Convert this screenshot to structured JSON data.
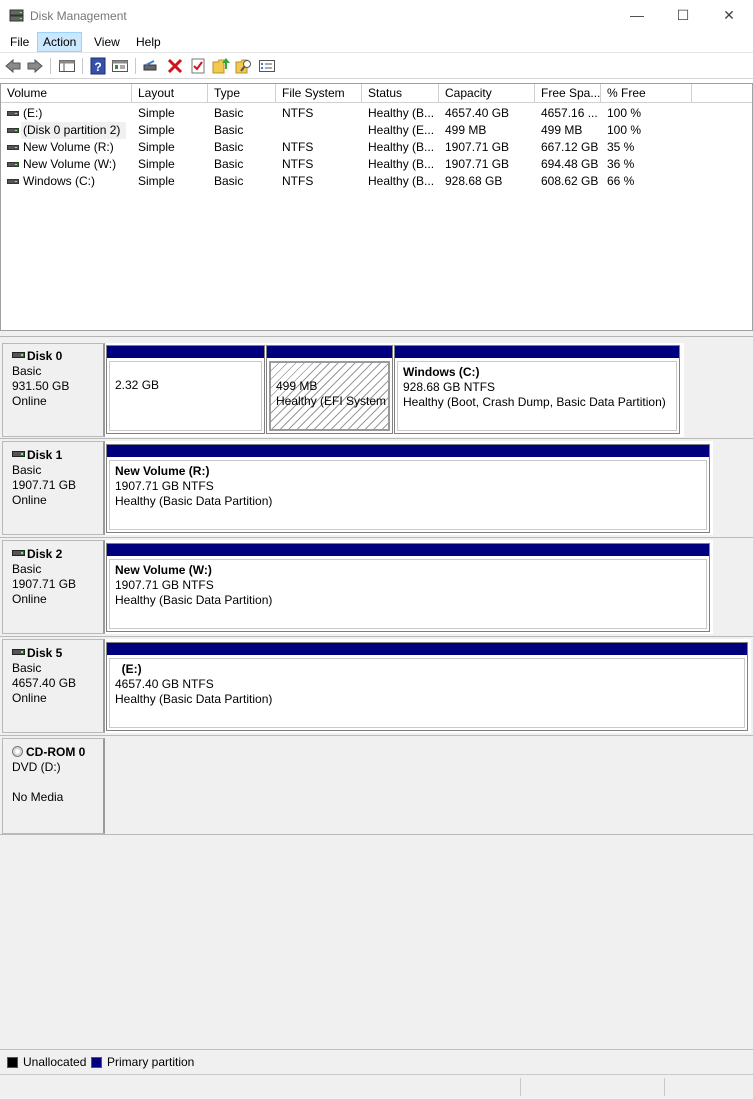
{
  "window": {
    "title": "Disk Management",
    "minimize_label": "—",
    "maximize_label": "☐",
    "close_label": "✕"
  },
  "menu": {
    "items": [
      "File",
      "Action",
      "View",
      "Help"
    ],
    "active": "Action"
  },
  "toolbar": {
    "buttons": [
      "back-icon",
      "forward-icon",
      "console-tree-icon",
      "help-icon",
      "properties-icon",
      "connect-icon",
      "delete-icon",
      "check-icon",
      "folder-up-icon",
      "search-folder-icon",
      "list-view-icon"
    ]
  },
  "volume_list": {
    "columns": [
      "Volume",
      "Layout",
      "Type",
      "File System",
      "Status",
      "Capacity",
      "Free Spa...",
      "% Free"
    ],
    "rows": [
      {
        "volume": " (E:)",
        "layout": "Simple",
        "type": "Basic",
        "fs": "NTFS",
        "status": "Healthy (B...",
        "capacity": "4657.40 GB",
        "free": "4657.16 ...",
        "pct": "100 %"
      },
      {
        "volume": "(Disk 0 partition 2)",
        "layout": "Simple",
        "type": "Basic",
        "fs": "",
        "status": "Healthy (E...",
        "capacity": "499 MB",
        "free": "499 MB",
        "pct": "100 %"
      },
      {
        "volume": "New Volume (R:)",
        "layout": "Simple",
        "type": "Basic",
        "fs": "NTFS",
        "status": "Healthy (B...",
        "capacity": "1907.71 GB",
        "free": "667.12 GB",
        "pct": "35 %"
      },
      {
        "volume": "New Volume (W:)",
        "layout": "Simple",
        "type": "Basic",
        "fs": "NTFS",
        "status": "Healthy (B...",
        "capacity": "1907.71 GB",
        "free": "694.48 GB",
        "pct": "36 %"
      },
      {
        "volume": "Windows (C:)",
        "layout": "Simple",
        "type": "Basic",
        "fs": "NTFS",
        "status": "Healthy (B...",
        "capacity": "928.68 GB",
        "free": "608.62 GB",
        "pct": "66 %"
      }
    ]
  },
  "disks": {
    "disk0": {
      "name": "Disk 0",
      "type": "Basic",
      "size": "931.50 GB",
      "state": "Online",
      "p1": {
        "line1": "2.32 GB"
      },
      "p2": {
        "line1": "499 MB",
        "line2": "Healthy (EFI System P"
      },
      "p3": {
        "title": "Windows  (C:)",
        "line1": "928.68 GB NTFS",
        "line2": "Healthy (Boot, Crash Dump, Basic Data Partition)"
      }
    },
    "disk1": {
      "name": "Disk 1",
      "type": "Basic",
      "size": "1907.71 GB",
      "state": "Online",
      "p1": {
        "title": "New Volume  (R:)",
        "line1": "1907.71 GB NTFS",
        "line2": "Healthy (Basic Data Partition)"
      }
    },
    "disk2": {
      "name": "Disk 2",
      "type": "Basic",
      "size": "1907.71 GB",
      "state": "Online",
      "p1": {
        "title": "New Volume  (W:)",
        "line1": "1907.71 GB NTFS",
        "line2": "Healthy (Basic Data Partition)"
      }
    },
    "disk5": {
      "name": "Disk 5",
      "type": "Basic",
      "size": "4657.40 GB",
      "state": "Online",
      "p1": {
        "title": "  (E:)",
        "line1": "4657.40 GB NTFS",
        "line2": "Healthy (Basic Data Partition)"
      }
    },
    "cdrom0": {
      "name": "CD-ROM 0",
      "type": "DVD (D:)",
      "state": "No Media"
    }
  },
  "legend": {
    "unallocated_label": "Unallocated",
    "primary_label": "Primary partition",
    "unallocated_color": "#000000",
    "primary_color": "#00007f"
  }
}
